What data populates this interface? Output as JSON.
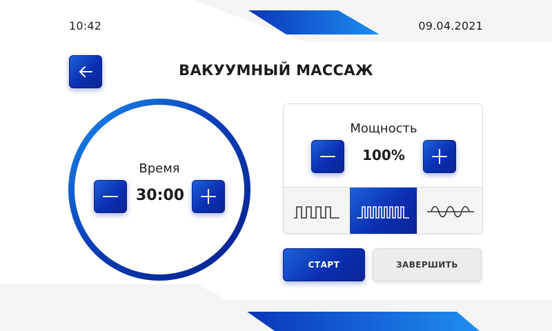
{
  "status_bar": {
    "time": "10:42",
    "date": "09.04.2021"
  },
  "header": {
    "title": "ВАКУУМНЫЙ МАССАЖ",
    "back_icon": "arrow-left-icon"
  },
  "timer": {
    "label": "Время",
    "value": "30:00",
    "minus_icon": "minus-icon",
    "plus_icon": "plus-icon"
  },
  "power": {
    "label": "Мощность",
    "value": "100%",
    "minus_icon": "minus-icon",
    "plus_icon": "plus-icon"
  },
  "modes": {
    "items": [
      {
        "icon": "sparse-pulse-wave-icon",
        "active": false
      },
      {
        "icon": "dense-pulse-wave-icon",
        "active": true
      },
      {
        "icon": "sine-wave-icon",
        "active": false
      }
    ]
  },
  "actions": {
    "start_label": "СТАРТ",
    "stop_label": "ЗАВЕРШИТЬ"
  },
  "colors": {
    "accent": "#0a2fb0",
    "accent_light": "#1d62d8",
    "text": "#1c1c1c",
    "panel_border": "#d6d6d6",
    "secondary_button": "#ececec"
  }
}
